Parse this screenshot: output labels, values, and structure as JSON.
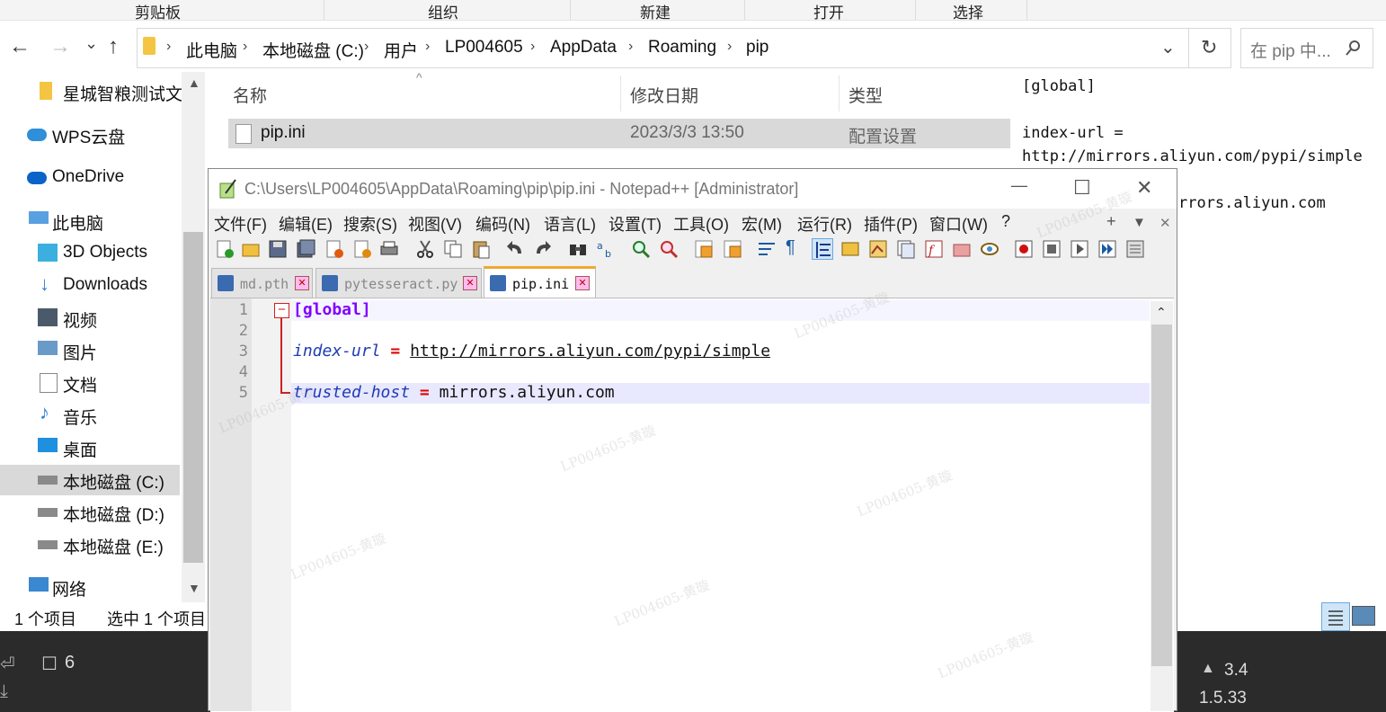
{
  "ribbon": {
    "groups": [
      "剪贴板",
      "组织",
      "新建",
      "打开",
      "选择"
    ]
  },
  "nav": {
    "back": "←",
    "forward": "→",
    "recent": "⌄",
    "up": "↑"
  },
  "address": {
    "crumbs": [
      "此电脑",
      "本地磁盘 (C:)",
      "用户",
      "LP004605",
      "AppData",
      "Roaming",
      "pip"
    ],
    "dropdown": "⌄",
    "refresh": "↻"
  },
  "search": {
    "placeholder": "在 pip 中..."
  },
  "sidebar": {
    "items": [
      {
        "label": "星城智粮测试文档",
        "icon": "folder-icon"
      },
      {
        "label": "WPS云盘",
        "icon": "cloud-icon"
      },
      {
        "label": "OneDrive",
        "icon": "cloud-icon"
      },
      {
        "label": "此电脑",
        "icon": "computer-icon"
      },
      {
        "label": "3D Objects",
        "icon": "cube-icon"
      },
      {
        "label": "Downloads",
        "icon": "download-icon"
      },
      {
        "label": "视频",
        "icon": "video-icon"
      },
      {
        "label": "图片",
        "icon": "picture-icon"
      },
      {
        "label": "文档",
        "icon": "document-icon"
      },
      {
        "label": "音乐",
        "icon": "music-icon"
      },
      {
        "label": "桌面",
        "icon": "desktop-icon"
      },
      {
        "label": "本地磁盘 (C:)",
        "icon": "drive-icon"
      },
      {
        "label": "本地磁盘 (D:)",
        "icon": "drive-icon"
      },
      {
        "label": "本地磁盘 (E:)",
        "icon": "drive-icon"
      },
      {
        "label": "网络",
        "icon": "network-icon"
      }
    ]
  },
  "filelist": {
    "columns": [
      "名称",
      "修改日期",
      "类型"
    ],
    "rows": [
      {
        "name": "pip.ini",
        "date": "2023/3/3 13:50",
        "type": "配置设置"
      }
    ]
  },
  "statusbar": {
    "count": "1 个项目",
    "selected": "选中 1 个项目"
  },
  "preview": {
    "lines": [
      "[global]",
      "",
      "index-url =",
      "http://mirrors.aliyun.com/pypi/simple",
      "",
      "trusted-host = mirrors.aliyun.com"
    ]
  },
  "notepad": {
    "title": "C:\\Users\\LP004605\\AppData\\Roaming\\pip\\pip.ini - Notepad++ [Administrator]",
    "window_buttons": {
      "minimize": "—",
      "maximize": "☐",
      "close": "✕"
    },
    "menu": [
      "文件(F)",
      "编辑(E)",
      "搜索(S)",
      "视图(V)",
      "编码(N)",
      "语言(L)",
      "设置(T)",
      "工具(O)",
      "宏(M)",
      "运行(R)",
      "插件(P)",
      "窗口(W)",
      "?"
    ],
    "menu_right": {
      "plus": "+",
      "down": "▼",
      "close": "✕"
    },
    "tabs": [
      {
        "label": "md.pth",
        "active": false
      },
      {
        "label": "pytesseract.py",
        "active": false
      },
      {
        "label": "pip.ini",
        "active": true
      }
    ],
    "line_numbers": [
      "1",
      "2",
      "3",
      "4",
      "5"
    ],
    "code": {
      "section": "[global]",
      "key1": "index-url",
      "eq": "=",
      "val1": "http://mirrors.aliyun.com/pypi/simple",
      "key2": "trusted-host",
      "val2": "mirrors.aliyun.com"
    },
    "fold_marker": "−"
  },
  "background": {
    "line_num": "6",
    "version_a": "3.4",
    "version_b": "1.5.33"
  },
  "watermark": "LP004605-黄璇",
  "colors": {
    "accent": "#0078d7",
    "np_key": "#1e3cb4",
    "np_section": "#8000ff",
    "np_op": "#e00000",
    "current_line": "#e8e8ff"
  }
}
